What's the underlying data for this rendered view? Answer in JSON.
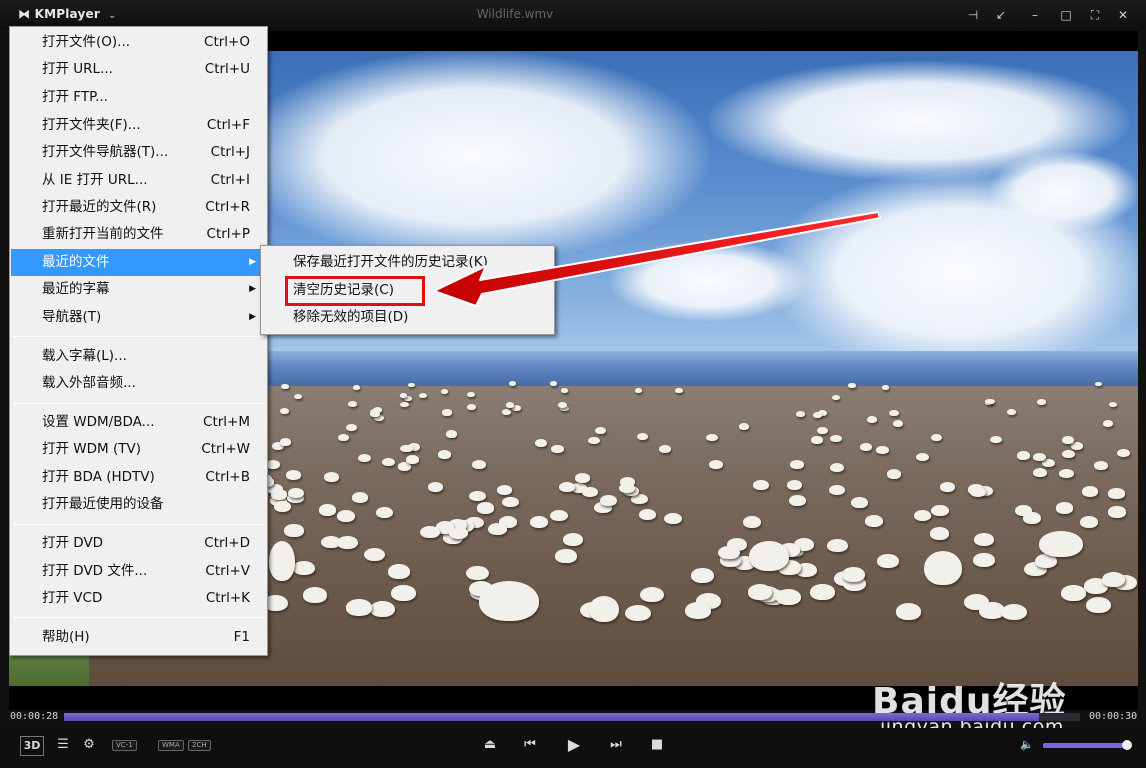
{
  "titlebar": {
    "app_name": "KMPlayer",
    "window_title": "Wildlife.wmv",
    "controls": [
      "pin-icon",
      "mini-icon",
      "minimize-icon",
      "maximize-icon",
      "fullscreen-icon",
      "close-icon"
    ]
  },
  "menu": {
    "items": [
      {
        "label": "打开文件(O)...",
        "shortcut": "Ctrl+O"
      },
      {
        "label": "打开 URL...",
        "shortcut": "Ctrl+U"
      },
      {
        "label": "打开 FTP...",
        "shortcut": ""
      },
      {
        "label": "打开文件夹(F)...",
        "shortcut": "Ctrl+F"
      },
      {
        "label": "打开文件导航器(T)...",
        "shortcut": "Ctrl+J"
      },
      {
        "label": "从 IE 打开 URL...",
        "shortcut": "Ctrl+I"
      },
      {
        "label": "打开最近的文件(R)",
        "shortcut": "Ctrl+R"
      },
      {
        "label": "重新打开当前的文件",
        "shortcut": "Ctrl+P"
      },
      {
        "label": "最近的文件",
        "shortcut": ""
      },
      {
        "label": "最近的字幕",
        "shortcut": ""
      },
      {
        "label": "导航器(T)",
        "shortcut": ""
      },
      {
        "label": "载入字幕(L)...",
        "shortcut": ""
      },
      {
        "label": "载入外部音频...",
        "shortcut": ""
      },
      {
        "label": "设置 WDM/BDA...",
        "shortcut": "Ctrl+M"
      },
      {
        "label": "打开 WDM (TV)",
        "shortcut": "Ctrl+W"
      },
      {
        "label": "打开 BDA (HDTV)",
        "shortcut": "Ctrl+B"
      },
      {
        "label": "打开最近使用的设备",
        "shortcut": ""
      },
      {
        "label": "打开 DVD",
        "shortcut": "Ctrl+D"
      },
      {
        "label": "打开 DVD 文件...",
        "shortcut": "Ctrl+V"
      },
      {
        "label": "打开 VCD",
        "shortcut": "Ctrl+K"
      },
      {
        "label": "帮助(H)",
        "shortcut": "F1"
      }
    ],
    "highlighted": "最近的文件"
  },
  "submenu": {
    "items": [
      {
        "label": "保存最近打开文件的历史记录(K)"
      },
      {
        "label": "清空历史记录(C)"
      },
      {
        "label": "移除无效的项目(D)"
      }
    ],
    "annotated_item": "清空历史记录(C)"
  },
  "player": {
    "elapsed": "00:00:28",
    "total": "00:00:30",
    "progress": 0.96,
    "volume": 0.95,
    "badges": [
      "VC-1",
      "WMA",
      "2CH"
    ],
    "btn_3d": "3D"
  },
  "watermark": {
    "brand": "Baidu经验",
    "url": "jingyan.baidu.com"
  },
  "colors": {
    "highlight": "#3399ff",
    "annotation": "#e01010",
    "progress": "#7a66d8"
  }
}
